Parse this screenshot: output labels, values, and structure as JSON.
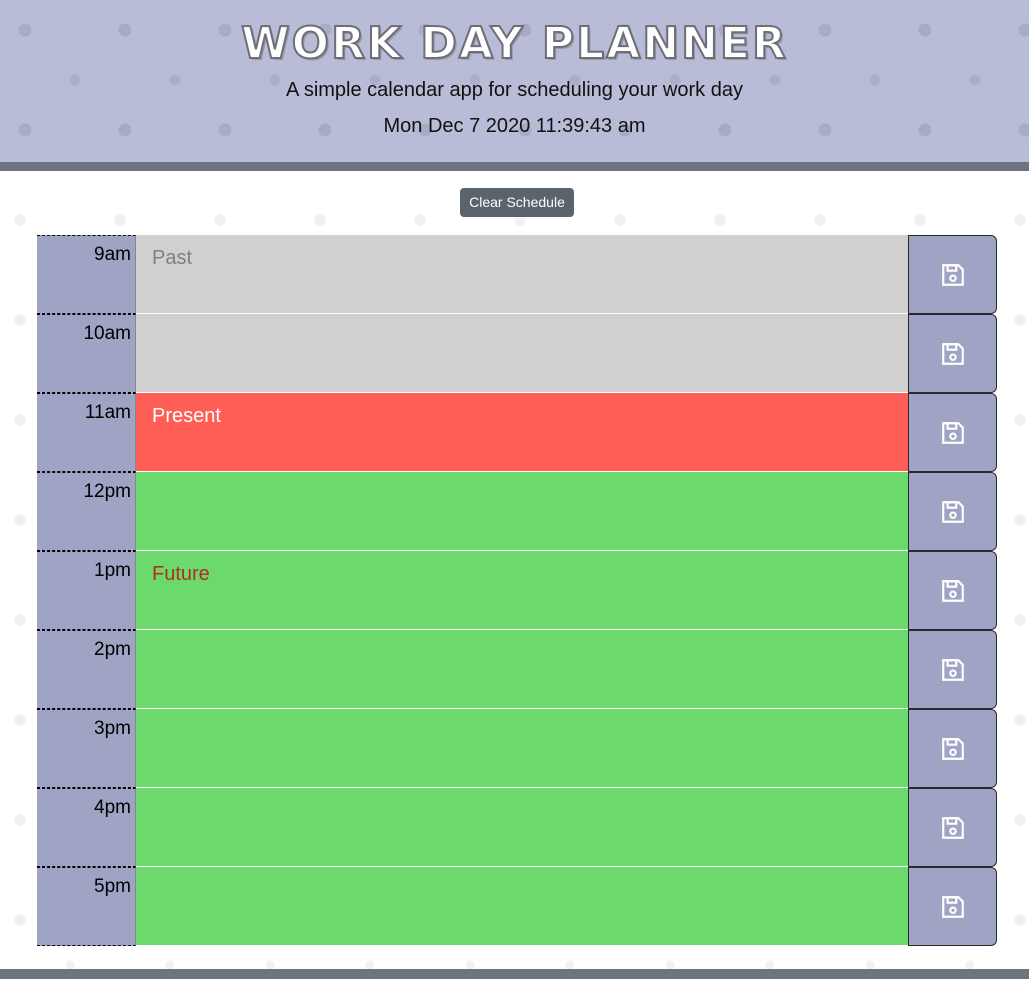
{
  "header": {
    "title": "WORK DAY PLANNER",
    "subtitle": "A simple calendar app for scheduling your work day",
    "datetime": "Mon Dec 7 2020 11:39:43 am"
  },
  "toolbar": {
    "clear_label": "Clear Schedule"
  },
  "rows": [
    {
      "hour": "9am",
      "text": "Past",
      "state": "past"
    },
    {
      "hour": "10am",
      "text": "",
      "state": "past"
    },
    {
      "hour": "11am",
      "text": "Present",
      "state": "present"
    },
    {
      "hour": "12pm",
      "text": "",
      "state": "future"
    },
    {
      "hour": "1pm",
      "text": "Future",
      "state": "future"
    },
    {
      "hour": "2pm",
      "text": "",
      "state": "future"
    },
    {
      "hour": "3pm",
      "text": "",
      "state": "future"
    },
    {
      "hour": "4pm",
      "text": "",
      "state": "future"
    },
    {
      "hour": "5pm",
      "text": "",
      "state": "future"
    }
  ],
  "icons": {
    "save": "floppy-disk-icon"
  },
  "colors": {
    "header_bg": "#b8bcd6",
    "past": "#d0d0d0",
    "present": "#ff5e57",
    "future": "#6cd96c",
    "hour_bg": "#a0a4c4"
  }
}
